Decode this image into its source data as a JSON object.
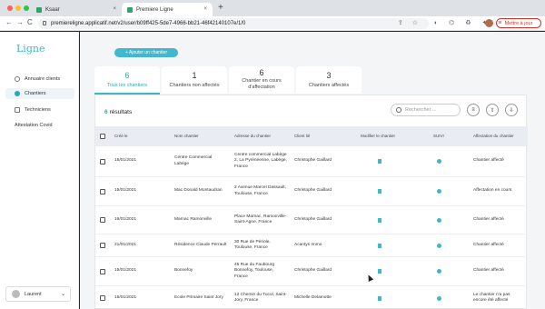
{
  "browser": {
    "tabs": [
      {
        "label": "Ksaar"
      },
      {
        "label": "Premiere Ligne"
      }
    ],
    "new_tab": "+",
    "url": "premiereligne.applicatif.net/v2/user/b09ff425-5de7-4966-bb21-46f42140107e/1/0",
    "update_button": "Mettre à jour",
    "back": "←",
    "forward": "→",
    "reload": "C",
    "close": "×"
  },
  "sidebar": {
    "logo": "Ligne",
    "items": [
      {
        "label": "Annuaire clients",
        "icon": "user-icon"
      },
      {
        "label": "Chantiers",
        "icon": "site-icon"
      },
      {
        "label": "Techniciens",
        "icon": "wrench-icon"
      },
      {
        "label": "Attestation Covid",
        "icon": ""
      }
    ],
    "user": "Laurent",
    "chevron": "⌄"
  },
  "main": {
    "add_button": "+ Ajouter un chantier",
    "filters": [
      {
        "count": "6",
        "label": "Tous les chantiers"
      },
      {
        "count": "1",
        "label": "Chantiers non affectés"
      },
      {
        "count": "6",
        "label": "Chantier en cours d'affectation"
      },
      {
        "count": "3",
        "label": "Chantiers affectés"
      }
    ],
    "results_count": "6",
    "results_label": "résultats",
    "search_placeholder": "Rechercher ...",
    "columns": [
      "Créé le",
      "Nom chantier",
      "Adresse du chantier",
      "Client lié",
      "Modifier le chantier",
      "SUIVI",
      "Affectation du chantier"
    ],
    "rows": [
      {
        "date": "15/01/2021",
        "name": "Centre Commercial Labège",
        "address": "Centre commercial Labège 2, La Pyrénéenne, Labège, France",
        "client": "Christophe Gaillard",
        "status": "Chantier affecté"
      },
      {
        "date": "15/01/2021",
        "name": "Mac Donald Montaudran",
        "address": "2 Avenue Marcel Dassault, Toulouse, France",
        "client": "Christophe Gaillard",
        "status": "Affectation en cours"
      },
      {
        "date": "16/01/2021",
        "name": "Marnac Ramonville",
        "address": "Place Marnac, Ramonville-Saint-Agne, France",
        "client": "Christophe Gaillard",
        "status": "Chantier affecté"
      },
      {
        "date": "21/01/2021",
        "name": "Résidence Claude Perrault",
        "address": "30 Rue de Périole, Toulouse, France",
        "client": "Acantys Immo",
        "status": "Chantier affecté"
      },
      {
        "date": "15/01/2021",
        "name": "Bonnefoy",
        "address": "45 Rue du Faubourg Bonnefoy, Toulouse, France",
        "client": "Christophe Gaillard",
        "status": "Chantier affecté"
      },
      {
        "date": "15/01/2021",
        "name": "Ecole Primaire Saint Jory",
        "address": "12 Chemin du Tucol, Saint-Jory, France",
        "client": "Michelle Delamotte",
        "status": "Le chantier n'a pas encore été affecté"
      }
    ]
  },
  "colors": {
    "accent": "#3db7c9",
    "update": "#d93025"
  }
}
